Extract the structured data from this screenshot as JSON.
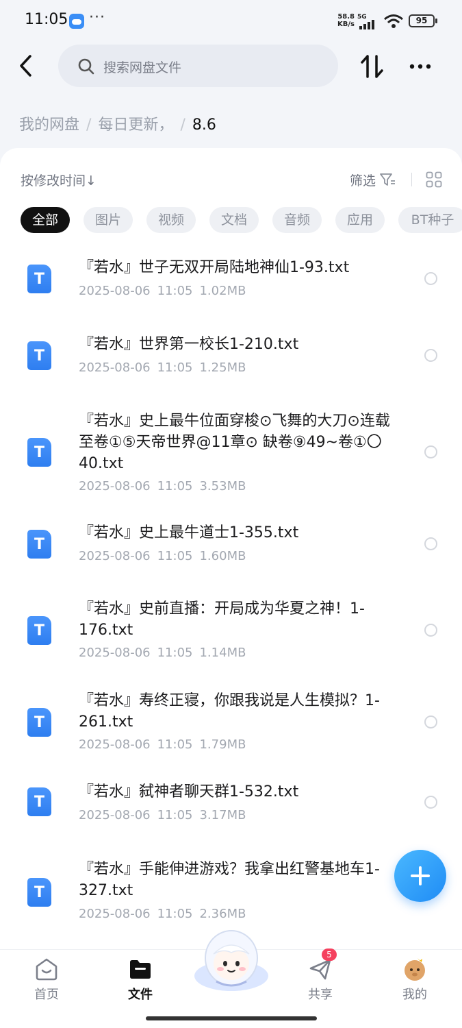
{
  "status_bar": {
    "time": "11:05",
    "dots": "···",
    "net_speed_value": "58.8",
    "net_speed_unit": "KB/s",
    "signal_label": "5G",
    "battery": "95"
  },
  "top_bar": {
    "search_placeholder": "搜索网盘文件"
  },
  "breadcrumb": {
    "items": [
      "我的网盘",
      "每日更新，"
    ],
    "current": "8.6"
  },
  "toolbar": {
    "sort_label": "按修改时间↓",
    "filter_label": "筛选"
  },
  "chips": [
    "全部",
    "图片",
    "视频",
    "文档",
    "音频",
    "应用",
    "BT种子"
  ],
  "files": [
    {
      "name": "『若水』世子无双开局陆地神仙1-93.txt",
      "date": "2025-08-06",
      "time": "11:05",
      "size": "1.02MB",
      "icon_letter": "T"
    },
    {
      "name": "『若水』世界第一校长1-210.txt",
      "date": "2025-08-06",
      "time": "11:05",
      "size": "1.25MB",
      "icon_letter": "T"
    },
    {
      "name": "『若水』史上最牛位面穿梭⊙飞舞的大刀⊙连载至卷①⑤天帝世界@11章⊙ 缺卷⑨49~卷①〇40.txt",
      "date": "2025-08-06",
      "time": "11:05",
      "size": "3.53MB",
      "icon_letter": "T"
    },
    {
      "name": "『若水』史上最牛道士1-355.txt",
      "date": "2025-08-06",
      "time": "11:05",
      "size": "1.60MB",
      "icon_letter": "T"
    },
    {
      "name": "『若水』史前直播：开局成为华夏之神！1-176.txt",
      "date": "2025-08-06",
      "time": "11:05",
      "size": "1.14MB",
      "icon_letter": "T"
    },
    {
      "name": "『若水』寿终正寝，你跟我说是人生模拟？1-261.txt",
      "date": "2025-08-06",
      "time": "11:05",
      "size": "1.79MB",
      "icon_letter": "T"
    },
    {
      "name": "『若水』弑神者聊天群1-532.txt",
      "date": "2025-08-06",
      "time": "11:05",
      "size": "3.17MB",
      "icon_letter": "T"
    },
    {
      "name": "『若水』手能伸进游戏？我拿出红警基地车1-327.txt",
      "date": "2025-08-06",
      "time": "11:05",
      "size": "2.36MB",
      "icon_letter": "T"
    }
  ],
  "bottom_nav": {
    "home": "首页",
    "files": "文件",
    "share": "共享",
    "share_badge": "5",
    "mine": "我的"
  },
  "colors": {
    "accent": "#2e7ef0",
    "badge": "#f5415e",
    "active_chip": "#111111"
  }
}
